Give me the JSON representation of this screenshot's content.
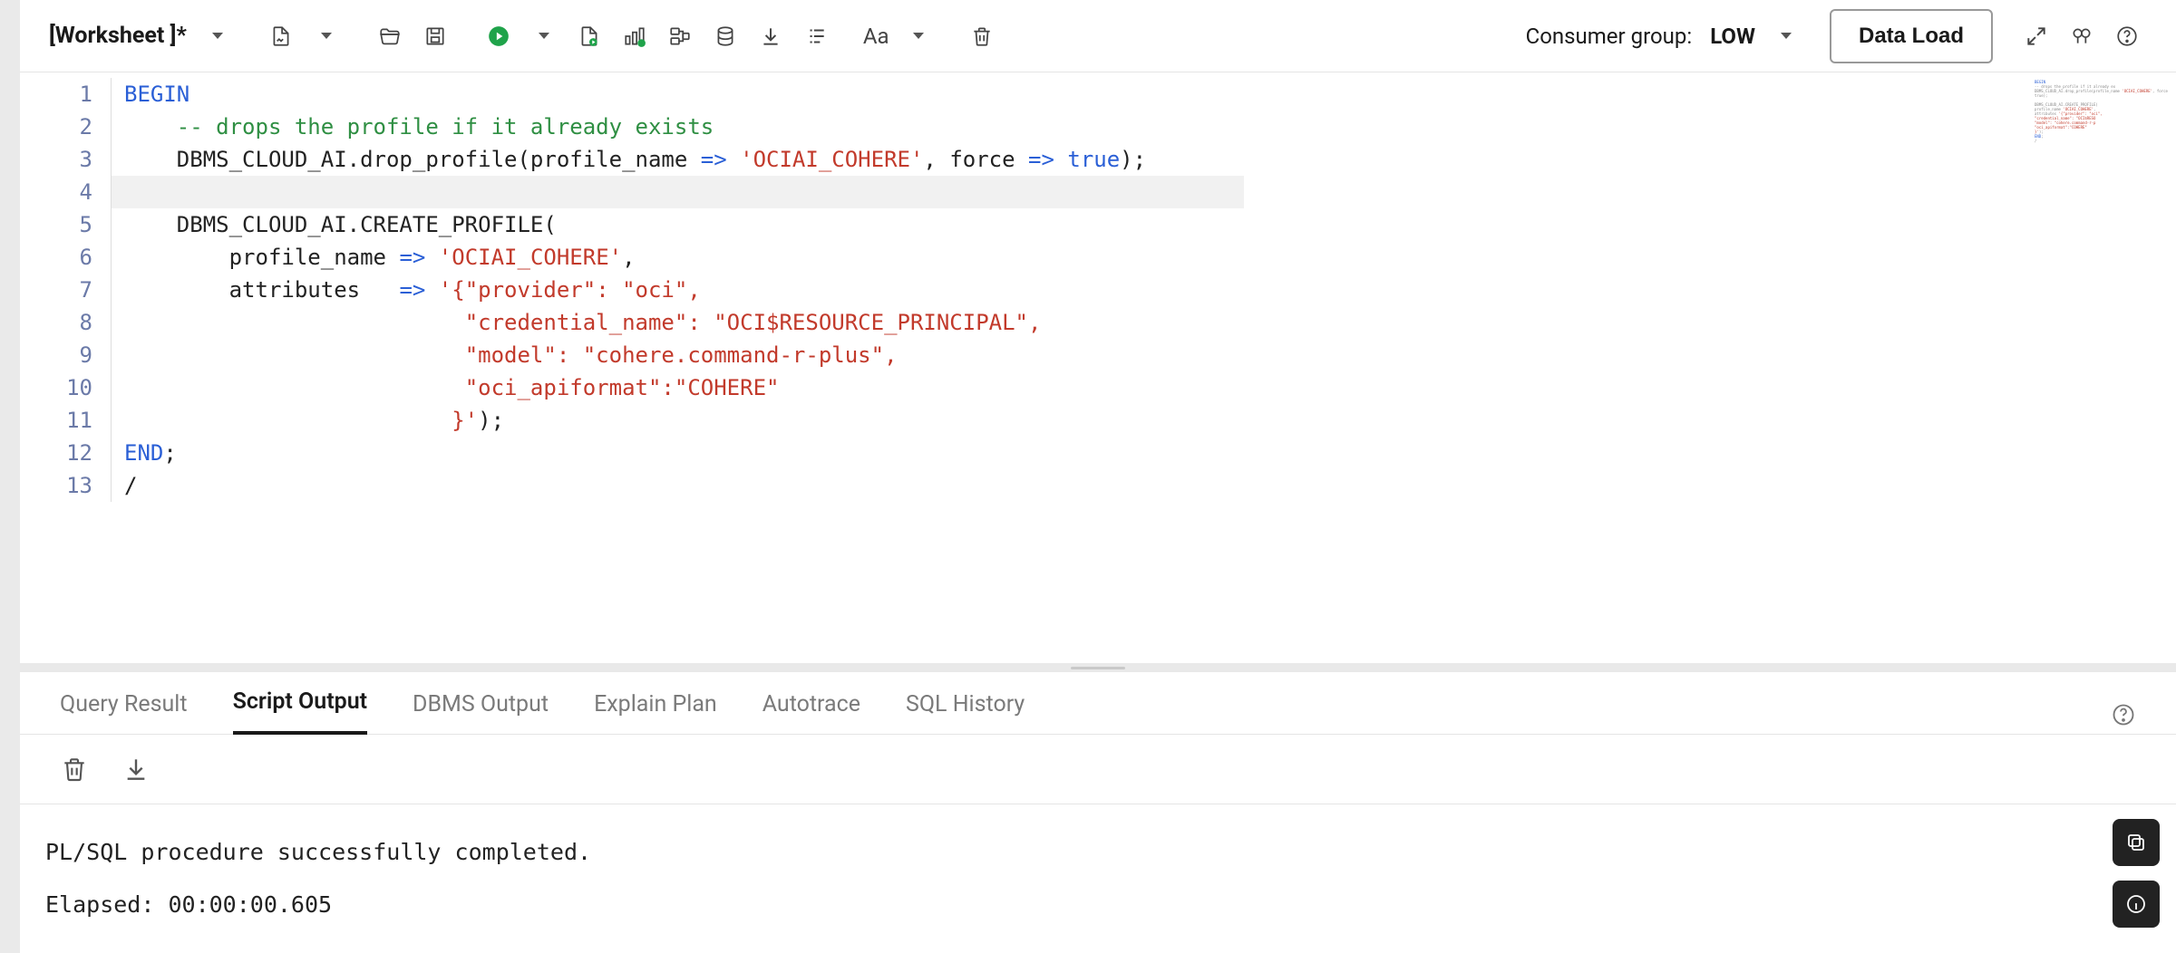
{
  "worksheet_name": "[Worksheet ]*",
  "consumer_group_label": "Consumer group:",
  "consumer_group_value": "LOW",
  "data_load_label": "Data Load",
  "code_lines": [
    {
      "n": 1,
      "raw": "BEGIN",
      "segs": [
        {
          "c": "kw",
          "t": "BEGIN"
        }
      ]
    },
    {
      "n": 2,
      "raw": "    -- drops the profile if it already exists",
      "segs": [
        {
          "c": "",
          "t": "    "
        },
        {
          "c": "cm",
          "t": "-- drops the profile if it already exists"
        }
      ]
    },
    {
      "n": 3,
      "raw": "    DBMS_CLOUD_AI.drop_profile(profile_name => 'OCIAI_COHERE', force => true);",
      "segs": [
        {
          "c": "",
          "t": "    DBMS_CLOUD_AI.drop_profile(profile_name "
        },
        {
          "c": "op",
          "t": "=>"
        },
        {
          "c": "",
          "t": " "
        },
        {
          "c": "str",
          "t": "'OCIAI_COHERE'"
        },
        {
          "c": "",
          "t": ", force "
        },
        {
          "c": "op",
          "t": "=>"
        },
        {
          "c": "",
          "t": " "
        },
        {
          "c": "kw",
          "t": "true"
        },
        {
          "c": "",
          "t": ");"
        }
      ]
    },
    {
      "n": 4,
      "raw": "",
      "segs": [],
      "current": true
    },
    {
      "n": 5,
      "raw": "    DBMS_CLOUD_AI.CREATE_PROFILE(",
      "segs": [
        {
          "c": "",
          "t": "    DBMS_CLOUD_AI.CREATE_PROFILE("
        }
      ]
    },
    {
      "n": 6,
      "raw": "        profile_name => 'OCIAI_COHERE',",
      "segs": [
        {
          "c": "",
          "t": "        profile_name "
        },
        {
          "c": "op",
          "t": "=>"
        },
        {
          "c": "",
          "t": " "
        },
        {
          "c": "str",
          "t": "'OCIAI_COHERE'"
        },
        {
          "c": "",
          "t": ","
        }
      ]
    },
    {
      "n": 7,
      "raw": "        attributes   => '{\"provider\": \"oci\",",
      "segs": [
        {
          "c": "",
          "t": "        attributes   "
        },
        {
          "c": "op",
          "t": "=>"
        },
        {
          "c": "",
          "t": " "
        },
        {
          "c": "str",
          "t": "'{\"provider\": \"oci\","
        }
      ]
    },
    {
      "n": 8,
      "raw": "                          \"credential_name\": \"OCI$RESOURCE_PRINCIPAL\",",
      "segs": [
        {
          "c": "",
          "t": "                          "
        },
        {
          "c": "str",
          "t": "\"credential_name\": \"OCI$RESOURCE_PRINCIPAL\","
        }
      ]
    },
    {
      "n": 9,
      "raw": "                          \"model\": \"cohere.command-r-plus\",",
      "segs": [
        {
          "c": "",
          "t": "                          "
        },
        {
          "c": "str",
          "t": "\"model\": \"cohere.command-r-plus\","
        }
      ]
    },
    {
      "n": 10,
      "raw": "                          \"oci_apiformat\":\"COHERE\"",
      "segs": [
        {
          "c": "",
          "t": "                          "
        },
        {
          "c": "str",
          "t": "\"oci_apiformat\":\"COHERE\""
        }
      ]
    },
    {
      "n": 11,
      "raw": "                         }');",
      "segs": [
        {
          "c": "",
          "t": "                         "
        },
        {
          "c": "str",
          "t": "}'"
        },
        {
          "c": "",
          "t": ");"
        }
      ]
    },
    {
      "n": 12,
      "raw": "END;",
      "segs": [
        {
          "c": "kw",
          "t": "END"
        },
        {
          "c": "",
          "t": ";"
        }
      ]
    },
    {
      "n": 13,
      "raw": "/",
      "segs": [
        {
          "c": "",
          "t": "/"
        }
      ]
    }
  ],
  "output_tabs": [
    "Query Result",
    "Script Output",
    "DBMS Output",
    "Explain Plan",
    "Autotrace",
    "SQL History"
  ],
  "output_active_tab": 1,
  "output_lines": [
    "PL/SQL procedure successfully completed.",
    "Elapsed: 00:00:00.605"
  ],
  "icons": {
    "new_file": "new-file-icon",
    "open": "open-folder-icon",
    "save": "save-icon",
    "run": "run-icon",
    "run_script": "run-script-icon",
    "explain": "explain-plan-icon",
    "autotrace": "autotrace-icon",
    "sqlhistory": "sql-history-icon",
    "download": "download-icon",
    "format": "format-icon",
    "font": "font-icon",
    "trash": "trash-icon",
    "expand": "expand-icon",
    "binoculars": "find-icon",
    "help": "help-icon",
    "copy": "copy-icon",
    "info": "info-icon"
  }
}
